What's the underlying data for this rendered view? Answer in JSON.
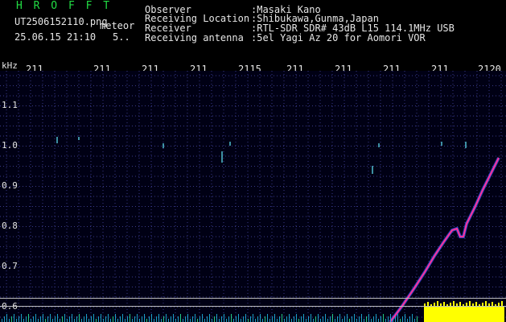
{
  "header": {
    "app_name": "H R O F F T",
    "filename": "UT2506152110.png",
    "tag": "meteor",
    "datetime": "25.06.15 21:10",
    "extra": "5..",
    "fields": [
      {
        "label": "Observer",
        "value": ":Masaki Kano"
      },
      {
        "label": "Receiving Location",
        "value": ":Shibukawa,Gunma,Japan"
      },
      {
        "label": "Receiver",
        "value": ":RTL-SDR SDR# 43dB L15 114.1MHz USB"
      },
      {
        "label": "Receiving antenna",
        "value": ":5el Yagi Az 20 for Aomori VOR"
      }
    ]
  },
  "axes": {
    "unit": "kHz",
    "y_ticks": [
      "1.1",
      "1.0",
      "0.9",
      "0.8",
      "0.7",
      "0.6"
    ],
    "x_ticks": [
      "211",
      "211",
      "211",
      "211",
      "2115",
      "211",
      "211",
      "211",
      "211",
      "2120"
    ]
  },
  "colors": {
    "text": "#e6e6e6",
    "title": "#22dd44",
    "grid": "#3a3a8a",
    "signal": "#ff3399",
    "noise": "#ffff00"
  }
}
